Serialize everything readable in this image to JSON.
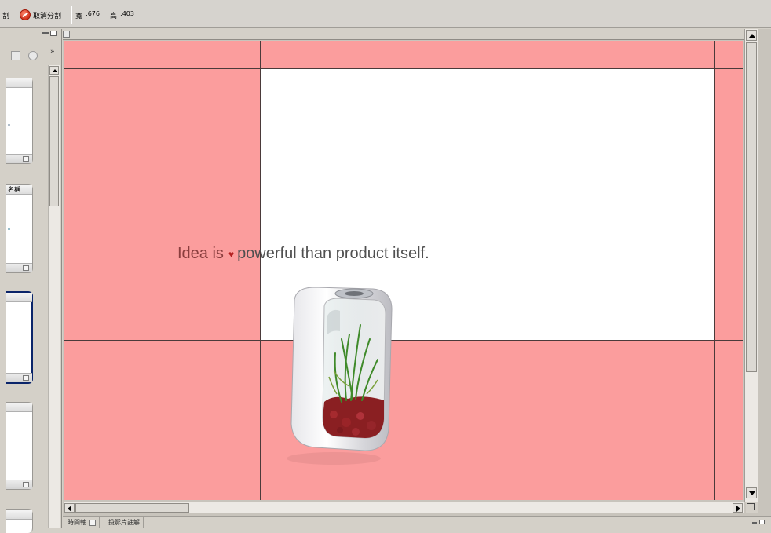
{
  "toolbar": {
    "fragment_label": "割",
    "cancel_split_label": "取消分割",
    "width_label": "寬",
    "width_value": ":676",
    "height_label": "高",
    "height_value": ":403"
  },
  "left_panel": {
    "more_label": "»",
    "thumbnails": [
      {
        "header": ""
      },
      {
        "header": "名稱"
      },
      {
        "header": ""
      },
      {
        "header": ""
      },
      {
        "header": ""
      }
    ]
  },
  "slide": {
    "tagline_part1": "Idea is",
    "tagline_heart": "♥",
    "tagline_part2": "powerful than product itself.",
    "colors": {
      "overlay": "#fb9d9d",
      "content_box": "#ffffff",
      "guide_lines": "#4a3a3a"
    }
  },
  "bottom_tabs": [
    {
      "label": "時間軸"
    },
    {
      "label": "投影片註解"
    }
  ]
}
